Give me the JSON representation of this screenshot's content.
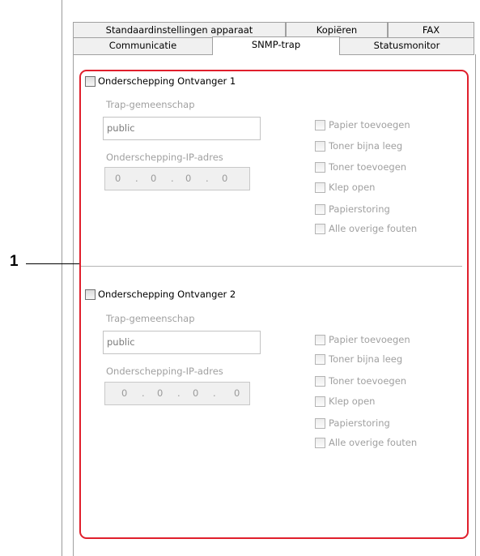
{
  "tabs_row1": [
    "Standaardinstellingen apparaat",
    "Kopiëren",
    "FAX"
  ],
  "tabs_row2": [
    "Communicatie",
    "SNMP-trap",
    "Statusmonitor"
  ],
  "active_tab": "SNMP-trap",
  "callout": "1",
  "receivers": [
    {
      "title": "Onderschepping Ontvanger 1",
      "community_label": "Trap-gemeenschap",
      "community_value": "public",
      "ip_label": "Onderschepping-IP-adres",
      "ip": [
        "0",
        "0",
        "0",
        "0"
      ],
      "events": [
        "Papier toevoegen",
        "Toner bijna leeg",
        "Toner toevoegen",
        "Klep open",
        "Papierstoring",
        "Alle overige fouten"
      ]
    },
    {
      "title": "Onderschepping Ontvanger 2",
      "community_label": "Trap-gemeenschap",
      "community_value": "public",
      "ip_label": "Onderschepping-IP-adres",
      "ip": [
        "0",
        "0",
        "0",
        "0"
      ],
      "events": [
        "Papier toevoegen",
        "Toner bijna leeg",
        "Toner toevoegen",
        "Klep open",
        "Papierstoring",
        "Alle overige fouten"
      ]
    }
  ],
  "colors": {
    "highlight": "#e01f2c",
    "disabled_text": "#a0a0a0"
  }
}
